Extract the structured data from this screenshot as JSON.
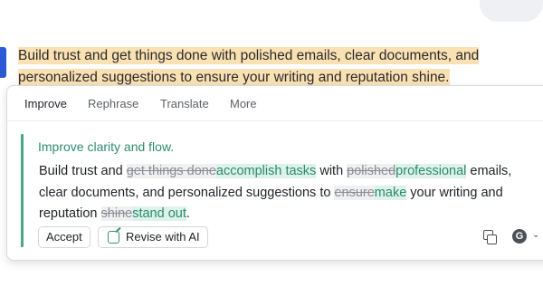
{
  "document": {
    "text": "Build trust and get things done with polished emails, clear documents, and personalized suggestions to ensure your writing and reputation shine."
  },
  "card": {
    "tabs": [
      {
        "label": "Improve"
      },
      {
        "label": "Rephrase"
      },
      {
        "label": "Translate"
      },
      {
        "label": "More"
      }
    ],
    "suggestion": {
      "title": "Improve clarity and flow.",
      "segments": [
        {
          "t": "Build trust and "
        },
        {
          "del": "get things done"
        },
        {
          "ins": "accomplish tasks"
        },
        {
          "t": " with "
        },
        {
          "del": "polished"
        },
        {
          "ins": "professional"
        },
        {
          "t": " emails, clear documents, and personalized suggestions to "
        },
        {
          "del": "ensure"
        },
        {
          "ins": "make"
        },
        {
          "t": " your writing and reputation "
        },
        {
          "del": "shine"
        },
        {
          "ins": "stand out"
        },
        {
          "t": "."
        }
      ]
    },
    "buttons": {
      "accept": "Accept",
      "revise": "Revise with AI"
    },
    "icons": {
      "copy": "copy-icon",
      "g": "G"
    }
  }
}
